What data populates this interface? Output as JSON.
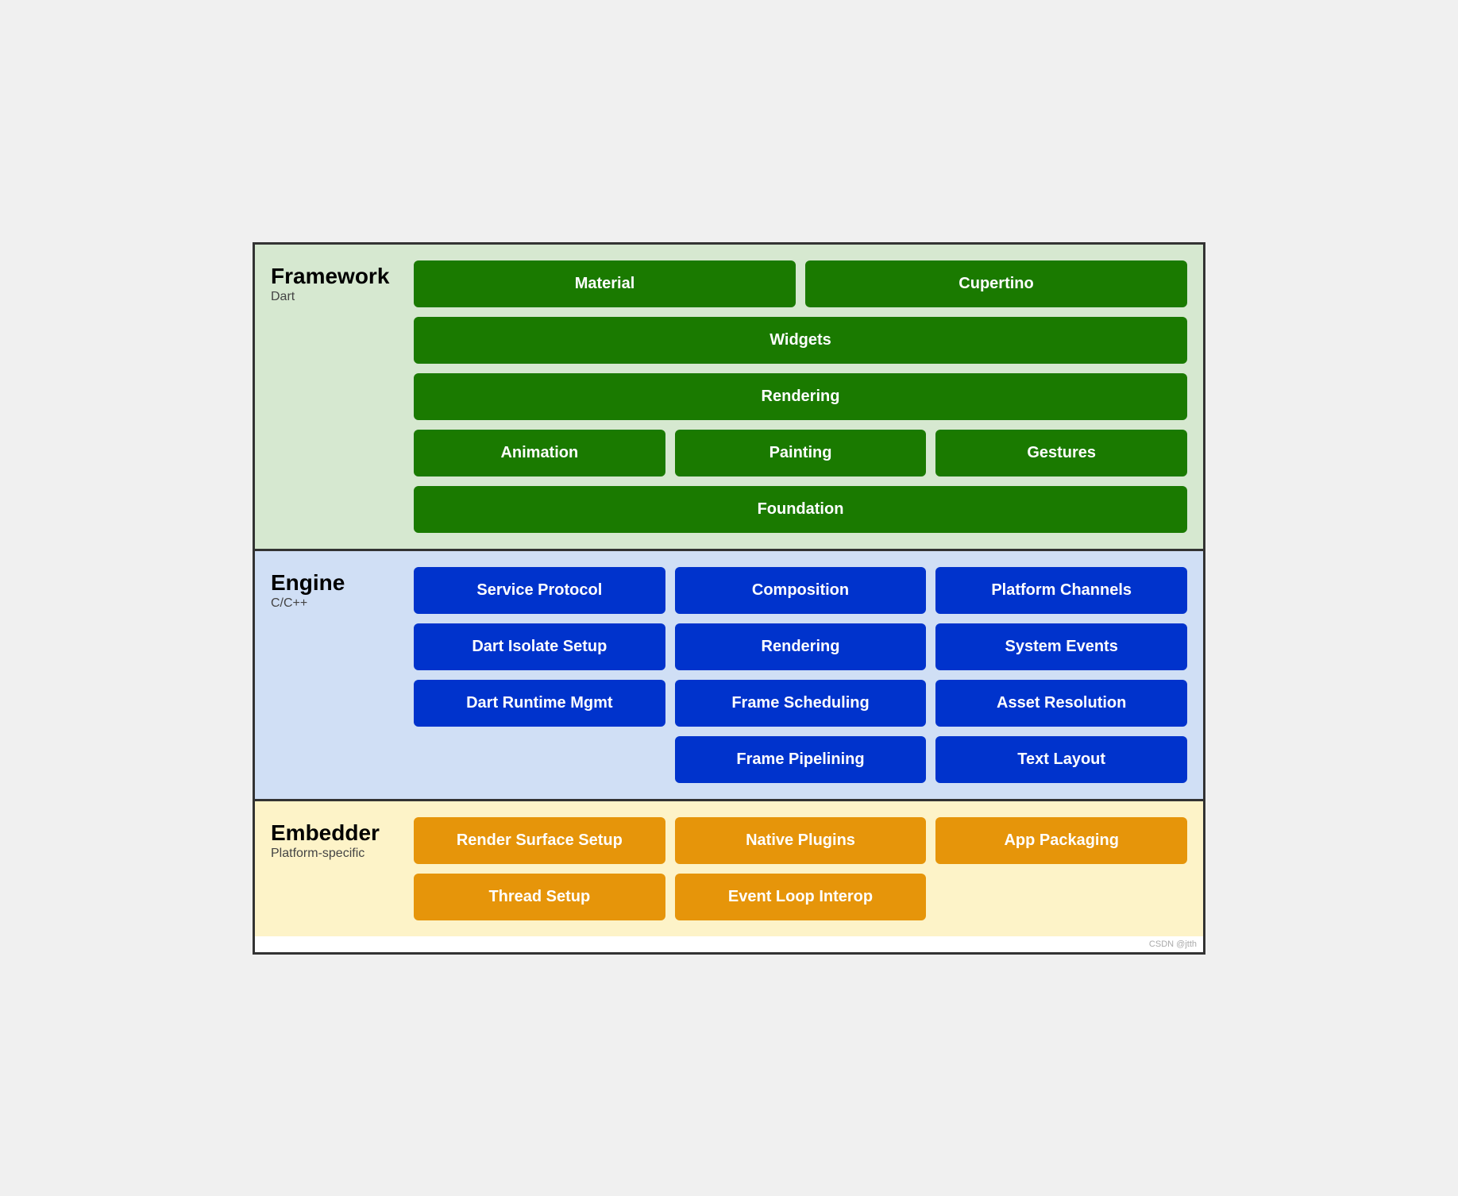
{
  "framework": {
    "title": "Framework",
    "subtitle": "Dart",
    "rows": [
      [
        {
          "label": "Material",
          "span": 1
        },
        {
          "label": "Cupertino",
          "span": 1
        }
      ],
      [
        {
          "label": "Widgets",
          "span": 2
        }
      ],
      [
        {
          "label": "Rendering",
          "span": 2
        }
      ],
      [
        {
          "label": "Animation",
          "span": 1
        },
        {
          "label": "Painting",
          "span": 1
        },
        {
          "label": "Gestures",
          "span": 1
        }
      ],
      [
        {
          "label": "Foundation",
          "span": 2
        }
      ]
    ]
  },
  "engine": {
    "title": "Engine",
    "subtitle": "C/C++",
    "rows": [
      [
        {
          "label": "Service Protocol"
        },
        {
          "label": "Composition"
        },
        {
          "label": "Platform Channels"
        }
      ],
      [
        {
          "label": "Dart Isolate Setup"
        },
        {
          "label": "Rendering"
        },
        {
          "label": "System Events"
        }
      ],
      [
        {
          "label": "Dart Runtime Mgmt"
        },
        {
          "label": "Frame Scheduling"
        },
        {
          "label": "Asset Resolution"
        }
      ],
      [
        {
          "label": ""
        },
        {
          "label": "Frame Pipelining"
        },
        {
          "label": "Text Layout"
        }
      ]
    ]
  },
  "embedder": {
    "title": "Embedder",
    "subtitle": "Platform-specific",
    "rows": [
      [
        {
          "label": "Render Surface Setup"
        },
        {
          "label": "Native Plugins"
        },
        {
          "label": "App Packaging"
        }
      ],
      [
        {
          "label": "Thread Setup"
        },
        {
          "label": "Event Loop Interop"
        },
        {
          "label": ""
        }
      ]
    ]
  },
  "watermark": "CSDN @jtth"
}
